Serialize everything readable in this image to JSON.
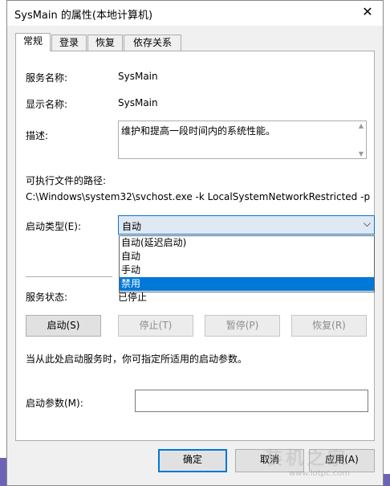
{
  "window": {
    "title": "SysMain 的属性(本地计算机)",
    "close_glyph": "✕"
  },
  "tabs": [
    {
      "label": "常规",
      "active": true
    },
    {
      "label": "登录",
      "active": false
    },
    {
      "label": "恢复",
      "active": false
    },
    {
      "label": "依存关系",
      "active": false
    }
  ],
  "general": {
    "service_name_label": "服务名称:",
    "service_name_value": "SysMain",
    "display_name_label": "显示名称:",
    "display_name_value": "SysMain",
    "description_label": "描述:",
    "description_value": "维护和提高一段时间内的系统性能。",
    "exe_path_label": "可执行文件的路径:",
    "exe_path_value": "C:\\Windows\\system32\\svchost.exe -k LocalSystemNetworkRestricted -p",
    "startup_type_label": "启动类型(E):",
    "startup_type_value": "自动",
    "startup_options": [
      "自动(延迟启动)",
      "自动",
      "手动",
      "禁用"
    ],
    "startup_highlighted": "禁用",
    "service_status_label": "服务状态:",
    "service_status_value": "已停止",
    "buttons": {
      "start": "启动(S)",
      "stop": "停止(T)",
      "pause": "暂停(P)",
      "resume": "恢复(R)"
    },
    "hint_text": "当从此处启动服务时，你可指定所适用的启动参数。",
    "start_params_label": "启动参数(M):",
    "start_params_value": ""
  },
  "footer": {
    "ok": "确定",
    "cancel": "取消",
    "apply": "应用(A)"
  },
  "watermark": {
    "text": "装机之家",
    "url": "www.lotpc.com"
  },
  "colors": {
    "accent": "#0078d7",
    "desktop": "#6b64b4"
  }
}
